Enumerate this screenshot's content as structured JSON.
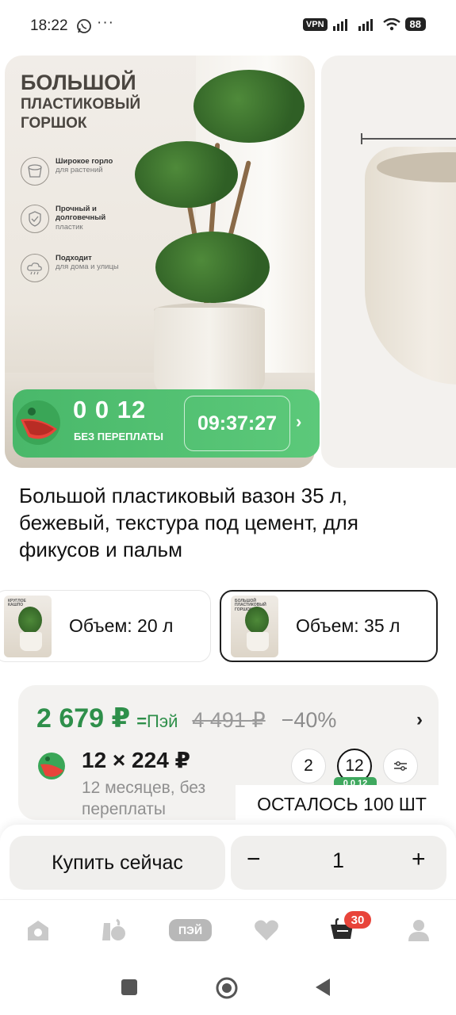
{
  "status_bar": {
    "time": "18:22",
    "dots": "···",
    "vpn": "VPN",
    "battery": "88"
  },
  "gallery": {
    "slide_title_line1": "БОЛЬШОЙ",
    "slide_title_line2": "ПЛАСТИКОВЫЙ",
    "slide_title_line3": "ГОРШОК",
    "features": [
      {
        "bold": "Широкое горло",
        "sub": "для растений",
        "icon": "pot-outline-icon"
      },
      {
        "bold": "Прочный и долговечный",
        "sub": "пластик",
        "icon": "shield-check-icon"
      },
      {
        "bold": "Подходит",
        "sub": "для дома и улицы",
        "icon": "weather-icon"
      }
    ],
    "promo": {
      "amount": "0 0 12",
      "subtitle": "БЕЗ ПЕРЕПЛАТЫ",
      "timer": "09:37:27",
      "arrow": "›",
      "color": "#4cbb6c"
    }
  },
  "product": {
    "title": "Большой пластиковый вазон 35 л, бежевый, текстура под цемент, для фикусов и пальм"
  },
  "variants": [
    {
      "label": "Объем: 20 л",
      "thumb_text": "КРУГЛОЕ КАШПО",
      "selected": false
    },
    {
      "label": "Объем: 35 л",
      "thumb_text": "БОЛЬШОЙ ПЛАСТИКОВЫЙ ГОРШОК",
      "selected": true
    }
  ],
  "price": {
    "current": "2 679 ₽",
    "pay_mark": "=",
    "pay_label": "Пэй",
    "old": "4 491 ₽",
    "discount": "−40%",
    "arrow": "›",
    "accent_color": "#2e8f4a"
  },
  "installment": {
    "amount": "12 × 224 ₽",
    "description": "12 месяцев, без переплаты",
    "terms": [
      "2",
      "12"
    ],
    "selected_term": "12",
    "badge": "0 0 12"
  },
  "stock_banner": "ОСТАЛОСЬ 100 ШТ",
  "buy_bar": {
    "buy_now": "Купить сейчас",
    "minus": "−",
    "quantity": "1",
    "plus": "+"
  },
  "tab_bar": {
    "items": [
      {
        "name": "home",
        "icon": "home-icon"
      },
      {
        "name": "catalog",
        "icon": "catalog-icon"
      },
      {
        "name": "pay",
        "label": "ПЭЙ"
      },
      {
        "name": "favorites",
        "icon": "heart-icon"
      },
      {
        "name": "cart",
        "icon": "cart-icon",
        "badge": "30"
      },
      {
        "name": "profile",
        "icon": "profile-icon"
      }
    ],
    "badge_color": "#e8443a"
  }
}
